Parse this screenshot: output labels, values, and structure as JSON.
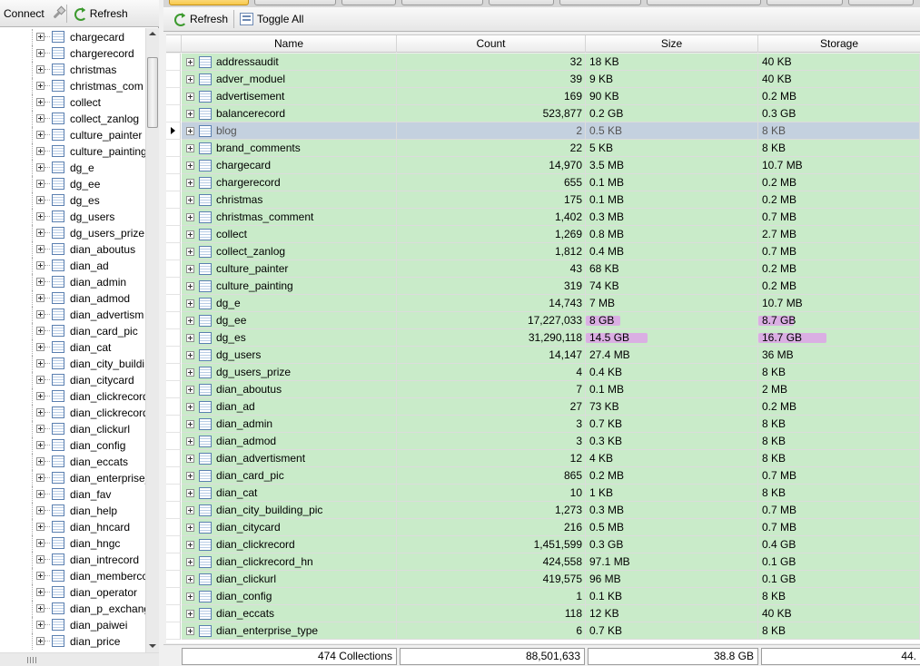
{
  "left_toolbar": {
    "connect_label": "Connect",
    "refresh_label": "Refresh"
  },
  "tree_items": [
    "chargecard",
    "chargerecord",
    "christmas",
    "christmas_com",
    "collect",
    "collect_zanlog",
    "culture_painter",
    "culture_painting",
    "dg_e",
    "dg_ee",
    "dg_es",
    "dg_users",
    "dg_users_prize",
    "dian_aboutus",
    "dian_ad",
    "dian_admin",
    "dian_admod",
    "dian_advertism",
    "dian_card_pic",
    "dian_cat",
    "dian_city_buildi",
    "dian_citycard",
    "dian_clickrecord",
    "dian_clickrecord",
    "dian_clickurl",
    "dian_config",
    "dian_eccats",
    "dian_enterprise_",
    "dian_fav",
    "dian_help",
    "dian_hncard",
    "dian_hngc",
    "dian_intrecord",
    "dian_membercc",
    "dian_operator",
    "dian_p_exchang",
    "dian_paiwei",
    "dian_price"
  ],
  "right_toolbar": {
    "refresh_label": "Refresh",
    "toggle_label": "Toggle All"
  },
  "columns": {
    "name": "Name",
    "count": "Count",
    "size": "Size",
    "storage": "Storage"
  },
  "highlight_color": "#dca8e6",
  "rows": [
    {
      "name": "addressaudit",
      "count": "32",
      "size": "18 KB",
      "storage": "40 KB"
    },
    {
      "name": "adver_moduel",
      "count": "39",
      "size": "9 KB",
      "storage": "40 KB"
    },
    {
      "name": "advertisement",
      "count": "169",
      "size": "90 KB",
      "storage": "0.2 MB"
    },
    {
      "name": "balancerecord",
      "count": "523,877",
      "size": "0.2 GB",
      "storage": "0.3 GB"
    },
    {
      "name": "blog",
      "count": "2",
      "size": "0.5 KB",
      "storage": "8 KB",
      "selected": true
    },
    {
      "name": "brand_comments",
      "count": "22",
      "size": "5 KB",
      "storage": "8 KB"
    },
    {
      "name": "chargecard",
      "count": "14,970",
      "size": "3.5 MB",
      "storage": "10.7 MB"
    },
    {
      "name": "chargerecord",
      "count": "655",
      "size": "0.1 MB",
      "storage": "0.2 MB"
    },
    {
      "name": "christmas",
      "count": "175",
      "size": "0.1 MB",
      "storage": "0.2 MB"
    },
    {
      "name": "christmas_comment",
      "count": "1,402",
      "size": "0.3 MB",
      "storage": "0.7 MB"
    },
    {
      "name": "collect",
      "count": "1,269",
      "size": "0.8 MB",
      "storage": "2.7 MB"
    },
    {
      "name": "collect_zanlog",
      "count": "1,812",
      "size": "0.4 MB",
      "storage": "0.7 MB"
    },
    {
      "name": "culture_painter",
      "count": "43",
      "size": "68 KB",
      "storage": "0.2 MB"
    },
    {
      "name": "culture_painting",
      "count": "319",
      "size": "74 KB",
      "storage": "0.2 MB"
    },
    {
      "name": "dg_e",
      "count": "14,743",
      "size": "7 MB",
      "storage": "10.7 MB"
    },
    {
      "name": "dg_ee",
      "count": "17,227,033",
      "size": "8 GB",
      "storage": "8.7 GB",
      "size_bar": 0.2,
      "storage_bar": 0.22
    },
    {
      "name": "dg_es",
      "count": "31,290,118",
      "size": "14.5 GB",
      "storage": "16.7 GB",
      "size_bar": 0.36,
      "storage_bar": 0.42
    },
    {
      "name": "dg_users",
      "count": "14,147",
      "size": "27.4 MB",
      "storage": "36 MB"
    },
    {
      "name": "dg_users_prize",
      "count": "4",
      "size": "0.4 KB",
      "storage": "8 KB"
    },
    {
      "name": "dian_aboutus",
      "count": "7",
      "size": "0.1 MB",
      "storage": "2 MB"
    },
    {
      "name": "dian_ad",
      "count": "27",
      "size": "73 KB",
      "storage": "0.2 MB"
    },
    {
      "name": "dian_admin",
      "count": "3",
      "size": "0.7 KB",
      "storage": "8 KB"
    },
    {
      "name": "dian_admod",
      "count": "3",
      "size": "0.3 KB",
      "storage": "8 KB"
    },
    {
      "name": "dian_advertisment",
      "count": "12",
      "size": "4 KB",
      "storage": "8 KB"
    },
    {
      "name": "dian_card_pic",
      "count": "865",
      "size": "0.2 MB",
      "storage": "0.7 MB"
    },
    {
      "name": "dian_cat",
      "count": "10",
      "size": "1 KB",
      "storage": "8 KB"
    },
    {
      "name": "dian_city_building_pic",
      "count": "1,273",
      "size": "0.3 MB",
      "storage": "0.7 MB"
    },
    {
      "name": "dian_citycard",
      "count": "216",
      "size": "0.5 MB",
      "storage": "0.7 MB"
    },
    {
      "name": "dian_clickrecord",
      "count": "1,451,599",
      "size": "0.3 GB",
      "storage": "0.4 GB"
    },
    {
      "name": "dian_clickrecord_hn",
      "count": "424,558",
      "size": "97.1 MB",
      "storage": "0.1 GB"
    },
    {
      "name": "dian_clickurl",
      "count": "419,575",
      "size": "96 MB",
      "storage": "0.1 GB"
    },
    {
      "name": "dian_config",
      "count": "1",
      "size": "0.1 KB",
      "storage": "8 KB"
    },
    {
      "name": "dian_eccats",
      "count": "118",
      "size": "12 KB",
      "storage": "40 KB"
    },
    {
      "name": "dian_enterprise_type",
      "count": "6",
      "size": "0.7 KB",
      "storage": "8 KB"
    }
  ],
  "footer": {
    "collections": "474 Collections",
    "total_count": "88,501,633",
    "total_size": "38.8 GB",
    "total_storage": "44."
  }
}
